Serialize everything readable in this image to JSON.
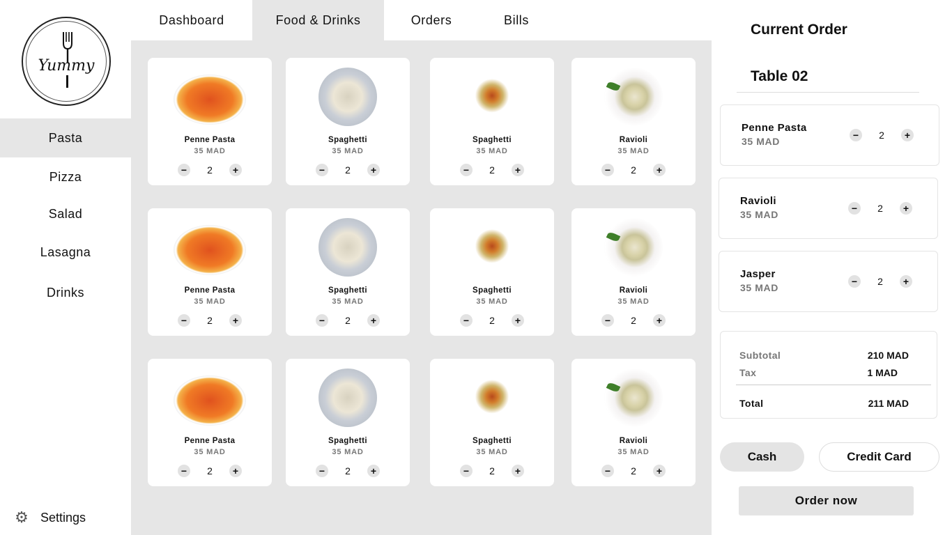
{
  "sidebar": {
    "logo_text": "Yummy",
    "categories": [
      {
        "label": "Pasta",
        "active": true
      },
      {
        "label": "Pizza",
        "active": false
      },
      {
        "label": "Salad",
        "active": false
      },
      {
        "label": "Lasagna",
        "active": false
      },
      {
        "label": "Drinks",
        "active": false
      }
    ],
    "settings_label": "Settings"
  },
  "tabs": [
    {
      "label": "Dashboard",
      "active": false
    },
    {
      "label": "Food & Drinks",
      "active": true
    },
    {
      "label": "Orders",
      "active": false
    },
    {
      "label": "Bills",
      "active": false
    }
  ],
  "menu_items": [
    {
      "name": "Penne Pasta",
      "price": "35 MAD",
      "qty": "2",
      "image": "pasta"
    },
    {
      "name": "Spaghetti",
      "price": "35 MAD",
      "qty": "2",
      "image": "spag"
    },
    {
      "name": "Spaghetti",
      "price": "35 MAD",
      "qty": "2",
      "image": "fus"
    },
    {
      "name": "Ravioli",
      "price": "35 MAD",
      "qty": "2",
      "image": "rav"
    },
    {
      "name": "Penne Pasta",
      "price": "35 MAD",
      "qty": "2",
      "image": "pasta"
    },
    {
      "name": "Spaghetti",
      "price": "35 MAD",
      "qty": "2",
      "image": "spag"
    },
    {
      "name": "Spaghetti",
      "price": "35 MAD",
      "qty": "2",
      "image": "fus"
    },
    {
      "name": "Ravioli",
      "price": "35 MAD",
      "qty": "2",
      "image": "rav"
    },
    {
      "name": "Penne Pasta",
      "price": "35 MAD",
      "qty": "2",
      "image": "pasta"
    },
    {
      "name": "Spaghetti",
      "price": "35 MAD",
      "qty": "2",
      "image": "spag"
    },
    {
      "name": "Spaghetti",
      "price": "35 MAD",
      "qty": "2",
      "image": "fus"
    },
    {
      "name": "Ravioli",
      "price": "35 MAD",
      "qty": "2",
      "image": "rav"
    }
  ],
  "order": {
    "title": "Current Order",
    "table": "Table 02",
    "items": [
      {
        "name": "Penne Pasta",
        "price": "35 MAD",
        "qty": "2"
      },
      {
        "name": "Ravioli",
        "price": "35 MAD",
        "qty": "2"
      },
      {
        "name": "Jasper",
        "price": "35 MAD",
        "qty": "2"
      }
    ],
    "subtotal_label": "Subtotal",
    "subtotal": "210 MAD",
    "tax_label": "Tax",
    "tax": "1 MAD",
    "total_label": "Total",
    "total": "211 MAD",
    "cash_label": "Cash",
    "card_label": "Credit Card",
    "order_label": "Order now"
  },
  "icons": {
    "minus": "minus-icon",
    "plus": "plus-icon",
    "settings": "gear-icon"
  }
}
